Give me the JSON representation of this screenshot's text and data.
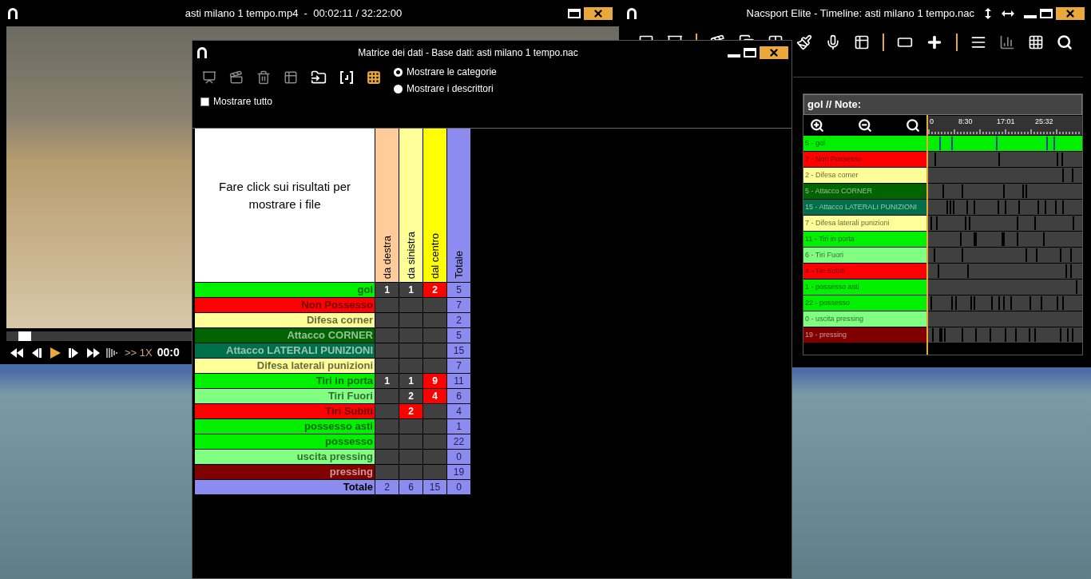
{
  "video_window": {
    "title": "asti milano 1 tempo.mp4  -  00:02:11 / 32:22:00",
    "progress": {
      "level": 0.02
    },
    "speed": ">> 1X",
    "time": "00:0"
  },
  "timeline_window": {
    "title": "Nacsport Elite - Timeline: asti milano 1 tempo.nac",
    "note": "gol // Note:",
    "ruler": [
      "0",
      "8:30",
      "17:01",
      "25:32"
    ],
    "rows": [
      {
        "label": "5 - gol",
        "color": "#00f000",
        "selected": true
      },
      {
        "label": "7 - Non Possesso",
        "color": "#ff0000",
        "selected": false
      },
      {
        "label": "2 - Difesa corner",
        "color": "#ffff99",
        "selected": false
      },
      {
        "label": "5 - Attacco CORNER",
        "color": "#006400",
        "selected": false
      },
      {
        "label": "15 - Attacco LATERALI  PUNIZIONI",
        "color": "#00704a",
        "selected": false
      },
      {
        "label": "7 - Difesa laterali  punizioni",
        "color": "#ffff99",
        "selected": false
      },
      {
        "label": "11 - Tiri in porta",
        "color": "#00f000",
        "selected": false
      },
      {
        "label": "6 - Tiri Fuori",
        "color": "#80ff80",
        "selected": false
      },
      {
        "label": "4 - Tiri Subiti",
        "color": "#ff0000",
        "selected": false
      },
      {
        "label": "1 - possesso asti",
        "color": "#00f000",
        "selected": false
      },
      {
        "label": "22 - possesso",
        "color": "#00f000",
        "selected": false
      },
      {
        "label": "0 - uscita pressing",
        "color": "#80ff80",
        "selected": false
      },
      {
        "label": "19 - pressing",
        "color": "#800000",
        "selected": false
      }
    ]
  },
  "matrix_window": {
    "title": "Matrice dei dati - Base dati: asti milano 1 tempo.nac",
    "radios": [
      {
        "label": "Mostrare le categorie",
        "selected": true
      },
      {
        "label": "Mostrare i descrittori",
        "selected": false
      }
    ],
    "show_all": {
      "label": "Mostrare tutto",
      "checked": false
    },
    "table": {
      "corner": "Fare click sui risultati per mostrare i file",
      "columns": [
        {
          "label": "da destra",
          "color": "#ffcc99"
        },
        {
          "label": "da sinistra",
          "color": "#ffff99"
        },
        {
          "label": "dal centro",
          "color": "#ffff00"
        },
        {
          "label": "Totale",
          "color": "#8c8cf0"
        }
      ],
      "rows": [
        {
          "label": "gol",
          "color": "#00f000",
          "cells": [
            {
              "value": "1",
              "highlighted": false
            },
            {
              "value": "1",
              "highlighted": false
            },
            {
              "value": "2",
              "highlighted": true
            }
          ],
          "total": "5"
        },
        {
          "label": "Non Possesso",
          "color": "#ff0000",
          "cells": [
            {
              "highlighted": false
            },
            {
              "highlighted": false
            },
            {
              "highlighted": false
            }
          ],
          "total": "7"
        },
        {
          "label": "Difesa corner",
          "color": "#ffff99",
          "cells": [
            {
              "highlighted": false
            },
            {
              "highlighted": false
            },
            {
              "highlighted": false
            }
          ],
          "total": "2"
        },
        {
          "label": "Attacco CORNER",
          "color": "#006400",
          "cells": [
            {
              "highlighted": false
            },
            {
              "highlighted": false
            },
            {
              "highlighted": false
            }
          ],
          "total": "5"
        },
        {
          "label": "Attacco LATERALI  PUNIZIONI",
          "color": "#00704a",
          "cells": [
            {
              "highlighted": false
            },
            {
              "highlighted": false
            },
            {
              "highlighted": false
            }
          ],
          "total": "15"
        },
        {
          "label": "Difesa laterali  punizioni",
          "color": "#ffff99",
          "cells": [
            {
              "highlighted": false
            },
            {
              "highlighted": false
            },
            {
              "highlighted": false
            }
          ],
          "total": "7"
        },
        {
          "label": "Tiri in porta",
          "color": "#00f000",
          "cells": [
            {
              "value": "1",
              "highlighted": false
            },
            {
              "value": "1",
              "highlighted": false
            },
            {
              "value": "9",
              "highlighted": true
            }
          ],
          "total": "11"
        },
        {
          "label": "Tiri Fuori",
          "color": "#80ff80",
          "cells": [
            {
              "highlighted": false
            },
            {
              "value": "2",
              "highlighted": false
            },
            {
              "value": "4",
              "highlighted": true
            }
          ],
          "total": "6"
        },
        {
          "label": "Tiri Subiti",
          "color": "#ff0000",
          "cells": [
            {
              "highlighted": false
            },
            {
              "value": "2",
              "highlighted": true
            },
            {
              "highlighted": false
            }
          ],
          "total": "4"
        },
        {
          "label": "possesso asti",
          "color": "#00f000",
          "cells": [
            {
              "highlighted": false
            },
            {
              "highlighted": false
            },
            {
              "highlighted": false
            }
          ],
          "total": "1"
        },
        {
          "label": "possesso",
          "color": "#00f000",
          "cells": [
            {
              "highlighted": false
            },
            {
              "highlighted": false
            },
            {
              "highlighted": false
            }
          ],
          "total": "22"
        },
        {
          "label": "uscita pressing",
          "color": "#80ff80",
          "cells": [
            {
              "highlighted": false
            },
            {
              "highlighted": false
            },
            {
              "highlighted": false
            }
          ],
          "total": "0"
        },
        {
          "label": "pressing",
          "color": "#800000",
          "cells": [
            {
              "highlighted": false
            },
            {
              "highlighted": false
            },
            {
              "highlighted": false
            }
          ],
          "total": "19"
        }
      ],
      "total_row": {
        "label": "Totale",
        "cells": [
          "2",
          "6",
          "15"
        ],
        "total": "0"
      }
    }
  }
}
